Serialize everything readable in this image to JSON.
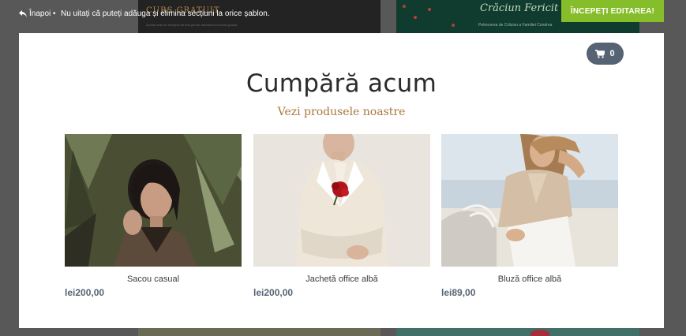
{
  "topbar": {
    "back_label": "Înapoi",
    "separator": "•",
    "help_text": "Nu uitați că puteți adăuga și elimina secțiuni la orice șablon."
  },
  "start_button": {
    "label": "ÎNCEPEȚI EDITAREA!"
  },
  "background": {
    "left_title": "CURS GRATUIT",
    "left_sub": "Acesta este un exemplu de text pentru descrierea cursului gratuit.",
    "right_title": "Crăciun Fericit",
    "right_sub": "Petrecerea de Crăciun a Familiei Condrea"
  },
  "cart": {
    "count": "0",
    "icon": "cart-icon"
  },
  "modal": {
    "title": "Cumpără acum",
    "subtitle": "Vezi produsele noastre"
  },
  "products": [
    {
      "name": "Sacou casual",
      "price": "lei200,00"
    },
    {
      "name": "Jachetă office albă",
      "price": "lei200,00"
    },
    {
      "name": "Bluză office albă",
      "price": "lei89,00"
    }
  ],
  "colors": {
    "accent_green": "#86bd2a",
    "cart_badge": "#566374",
    "subtitle_gold": "#a8773a"
  }
}
